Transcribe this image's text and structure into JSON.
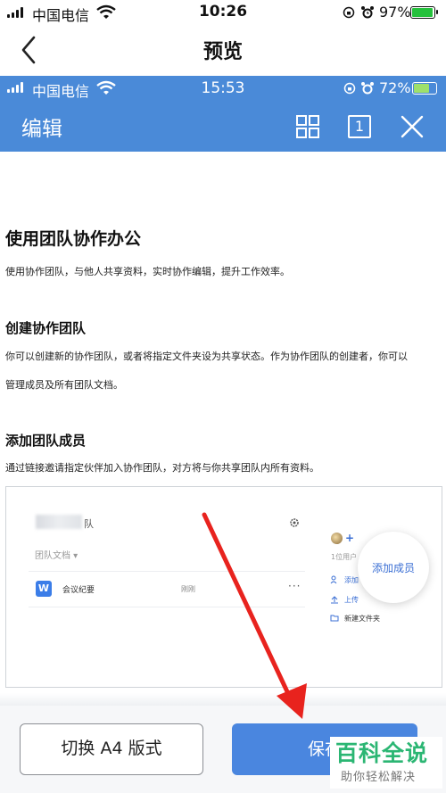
{
  "status_outer": {
    "carrier": "中国电信",
    "time": "10:26",
    "battery": "97%"
  },
  "nav": {
    "title": "预览"
  },
  "status_inner": {
    "carrier": "中国电信",
    "time": "15:53",
    "battery": "72%"
  },
  "editor": {
    "title": "编辑",
    "page_indicator": "1"
  },
  "document": {
    "heading1": "使用团队协作办公",
    "para1": "使用协作团队，与他人共享资料，实时协作编辑，提升工作效率。",
    "heading2": "创建协作团队",
    "para2a": "你可以创建新的协作团队，或者将指定文件夹设为共享状态。作为协作团队的创建者，你可以",
    "para2b": "管理成员及所有团队文档。",
    "heading3": "添加团队成员",
    "para3": "通过链接邀请指定伙伴加入协作团队，对方将与你共享团队内所有资料。"
  },
  "embedded": {
    "team_suffix": "队",
    "team_docs": "团队文档 ▾",
    "doc_row": {
      "name": "会议纪要",
      "time": "刚刚",
      "more": "···"
    },
    "members_count": "1位用户",
    "side_items": [
      "添加",
      "上传",
      "新建文件夹"
    ],
    "add_member": "添加成员"
  },
  "buttons": {
    "switch_a4": "切换 A4 版式",
    "save": "保存"
  },
  "watermark": {
    "title": "百科全说",
    "subtitle": "助你轻松解决"
  },
  "colors": {
    "accent": "#4a8ad8",
    "save_button": "#4a86df",
    "arrow": "#e8231e",
    "watermark": "#2bb673"
  }
}
